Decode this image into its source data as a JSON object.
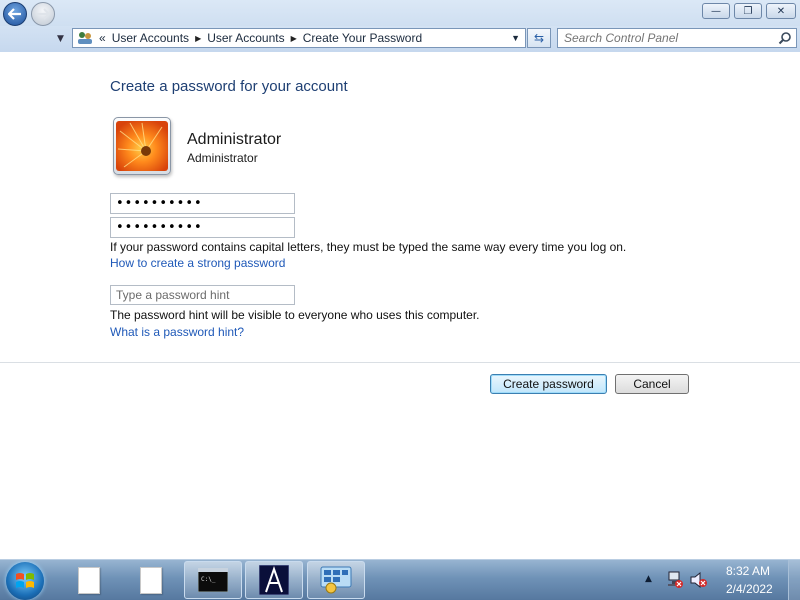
{
  "window": {
    "minimize_glyph": "—",
    "maximize_glyph": "❐",
    "close_glyph": "✕"
  },
  "navigation": {
    "address_prefix": "«",
    "breadcrumbs": [
      "User Accounts",
      "User Accounts",
      "Create Your Password"
    ],
    "search_placeholder": "Search Control Panel"
  },
  "content": {
    "title": "Create a password for your account",
    "account_name": "Administrator",
    "account_type": "Administrator",
    "new_password_value": "••••••••••",
    "confirm_password_value": "••••••••••",
    "caps_note": "If your password contains capital letters, they must be typed the same way every time you log on.",
    "strong_password_link": "How to create a strong password",
    "hint_placeholder": "Type a password hint",
    "hint_note": "The password hint will be visible to everyone who uses this computer.",
    "hint_link": "What is a password hint?",
    "create_button": "Create password",
    "cancel_button": "Cancel"
  },
  "taskbar": {
    "items": [
      "document-icon",
      "document-icon",
      "command-prompt-icon",
      "app-a-icon",
      "control-panel-icon"
    ],
    "active_item": "control-panel-icon",
    "time": "8:32 AM",
    "date": "2/4/2022"
  },
  "colors": {
    "title_text": "#1e3f73",
    "link_text": "#1f59b8",
    "taskbar": "#6f92b7"
  }
}
